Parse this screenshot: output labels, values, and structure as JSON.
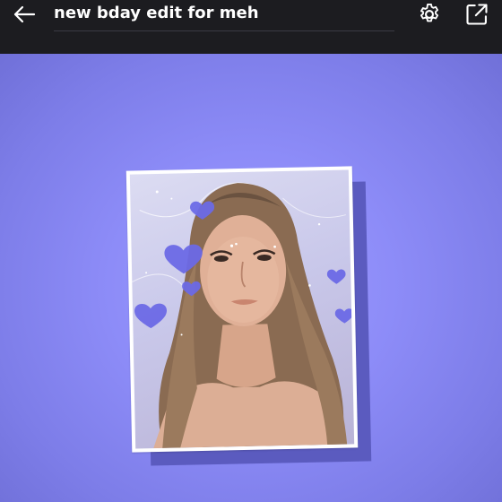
{
  "header": {
    "title": "new bday edit for meh",
    "back_icon": "back-arrow-icon",
    "settings_icon": "gear-icon",
    "share_icon": "open-external-icon"
  },
  "colors": {
    "topbar": "#1c1c20",
    "background": "#7f7ff0",
    "accent_purple": "#6a68e0",
    "heart": "#6c6ae6",
    "frame_shadow": "#5b5bbf"
  },
  "photo": {
    "subject": "selfie-portrait",
    "decoration": "purple-hearts-and-sparkles"
  }
}
